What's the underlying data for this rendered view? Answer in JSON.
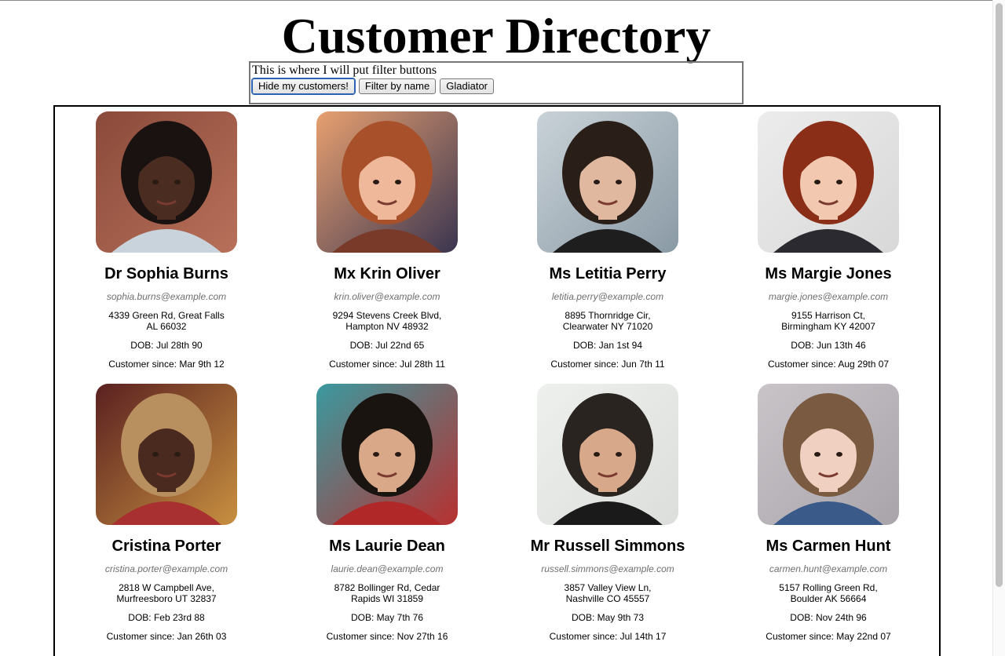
{
  "page": {
    "title": "Customer Directory"
  },
  "filters": {
    "text": "This is where I will put filter buttons",
    "buttons": [
      "Hide my customers!",
      "Filter by name",
      "Gladiator"
    ]
  },
  "customers": [
    {
      "name": "Dr Sophia Burns",
      "email": "sophia.burns@example.com",
      "address": "4339 Green Rd, Great Falls AL 66032",
      "dob": "DOB: Jul 28th 90",
      "since": "Customer since: Mar 9th 12",
      "photo": {
        "bg": "#8a4a3a",
        "bg2": "#b8705a",
        "skin": "#4a2c20",
        "hair": "#1a1210",
        "shirt": "#c9d3dc"
      }
    },
    {
      "name": "Mx Krin Oliver",
      "email": "krin.oliver@example.com",
      "address": "9294 Stevens Creek Blvd, Hampton NV 48932",
      "dob": "DOB: Jul 22nd 65",
      "since": "Customer since: Jul 28th 11",
      "photo": {
        "bg": "#e8a070",
        "bg2": "#3a3550",
        "skin": "#f0b89a",
        "hair": "#a8502a",
        "shirt": "#7a3a2a"
      }
    },
    {
      "name": "Ms Letitia Perry",
      "email": "letitia.perry@example.com",
      "address": "8895 Thornridge Cir, Clearwater NY 71020",
      "dob": "DOB: Jan 1st 94",
      "since": "Customer since: Jun 7th 11",
      "photo": {
        "bg": "#c9d2d8",
        "bg2": "#8a9aa5",
        "skin": "#e0b8a0",
        "hair": "#2a1e18",
        "shirt": "#1e1e1e"
      }
    },
    {
      "name": "Ms Margie Jones",
      "email": "margie.jones@example.com",
      "address": "9155 Harrison Ct, Birmingham KY 42007",
      "dob": "DOB: Jun 13th 46",
      "since": "Customer since: Aug 29th 07",
      "photo": {
        "bg": "#ececec",
        "bg2": "#d8d8d8",
        "skin": "#f2c8b0",
        "hair": "#8a2e18",
        "shirt": "#2a2a30"
      }
    },
    {
      "name": "Cristina Porter",
      "email": "cristina.porter@example.com",
      "address": "2818 W Campbell Ave, Murfreesboro UT 32837",
      "dob": "DOB: Feb 23rd 88",
      "since": "Customer since: Jan 26th 03",
      "photo": {
        "bg": "#5a2020",
        "bg2": "#c89040",
        "skin": "#4a2a1e",
        "hair": "#b89060",
        "shirt": "#a83030"
      }
    },
    {
      "name": "Ms Laurie Dean",
      "email": "laurie.dean@example.com",
      "address": "8782 Bollinger Rd, Cedar Rapids WI 31859",
      "dob": "DOB: May 7th 76",
      "since": "Customer since: Nov 27th 16",
      "photo": {
        "bg": "#3a9aa0",
        "bg2": "#b83030",
        "skin": "#d8a888",
        "hair": "#1a1410",
        "shirt": "#b02828"
      }
    },
    {
      "name": "Mr Russell Simmons",
      "email": "russell.simmons@example.com",
      "address": "3857 Valley View Ln, Nashville CO 45557",
      "dob": "DOB: May 9th 73",
      "since": "Customer since: Jul 14th 17",
      "photo": {
        "bg": "#eef0ee",
        "bg2": "#dcdedc",
        "skin": "#d8a88a",
        "hair": "#2a2420",
        "shirt": "#1a1a1a"
      }
    },
    {
      "name": "Ms Carmen Hunt",
      "email": "carmen.hunt@example.com",
      "address": "5157 Rolling Green Rd, Boulder AK 56664",
      "dob": "DOB: Nov 24th 96",
      "since": "Customer since: May 22nd 07",
      "photo": {
        "bg": "#c8c4c8",
        "bg2": "#a8a4aa",
        "skin": "#f0d0c0",
        "hair": "#7a5a40",
        "shirt": "#3a5a8a"
      }
    }
  ]
}
